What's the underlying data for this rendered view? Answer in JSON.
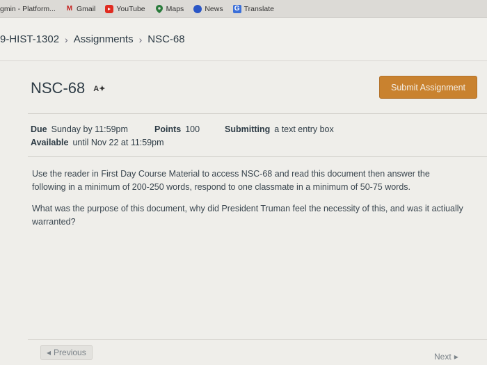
{
  "bookmarks": [
    {
      "label": "gmin - Platform...",
      "icon": "none"
    },
    {
      "label": "Gmail",
      "icon": "gmail-icon"
    },
    {
      "label": "YouTube",
      "icon": "youtube-icon"
    },
    {
      "label": "Maps",
      "icon": "maps-icon"
    },
    {
      "label": "News",
      "icon": "news-icon"
    },
    {
      "label": "Translate",
      "icon": "translate-icon"
    }
  ],
  "breadcrumb": {
    "course": "9-HIST-1302",
    "section": "Assignments",
    "current": "NSC-68"
  },
  "assignment": {
    "title": "NSC-68",
    "submit_label": "Submit Assignment",
    "due_label": "Due",
    "due_value": "Sunday by 11:59pm",
    "points_label": "Points",
    "points_value": "100",
    "submitting_label": "Submitting",
    "submitting_value": "a text entry box",
    "available_label": "Available",
    "available_value": "until Nov 22 at 11:59pm",
    "paragraph1": "Use the reader in First Day Course Material to access NSC-68 and read this document then answer the following in a minimum of 200-250 words, respond to one classmate in a minimum of 50-75 words.",
    "paragraph2": "What was the purpose of this document, why did President Truman feel the necessity of this, and was it actiually warranted?"
  },
  "nav": {
    "previous": "Previous",
    "next": "Next"
  },
  "colors": {
    "accent": "#c9822f"
  }
}
